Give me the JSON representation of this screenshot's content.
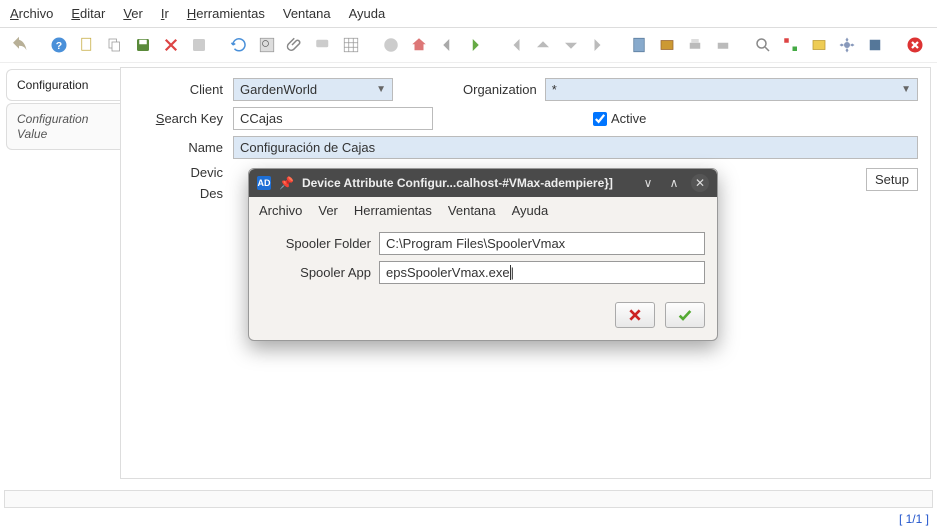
{
  "menu": {
    "archivo": "Archivo",
    "editar": "Editar",
    "ver": "Ver",
    "ir": "Ir",
    "herramientas": "Herramientas",
    "ventana": "Ventana",
    "ayuda": "Ayuda"
  },
  "tabs": {
    "config": "Configuration",
    "configValue": "Configuration Value"
  },
  "form": {
    "client_label": "Client",
    "client_value": "GardenWorld",
    "org_label": "Organization",
    "org_value": "*",
    "search_label": "Search Key",
    "search_value": "CCajas",
    "active_label": "Active",
    "name_label": "Name",
    "name_value": "Configuración de Cajas",
    "device_label": "Devic",
    "desc_label": "Des",
    "setup": "Setup"
  },
  "dialog": {
    "title": "Device Attribute Configur...calhost-#VMax-adempiere}]",
    "menu": {
      "archivo": "Archivo",
      "ver": "Ver",
      "herramientas": "Herramientas",
      "ventana": "Ventana",
      "ayuda": "Ayuda"
    },
    "spooler_folder_label": "Spooler Folder",
    "spooler_folder_value": "C:\\Program Files\\SpoolerVmax",
    "spooler_app_label": "Spooler App",
    "spooler_app_value": "epsSpoolerVmax.exe"
  },
  "status": "[ 1/1 ]"
}
